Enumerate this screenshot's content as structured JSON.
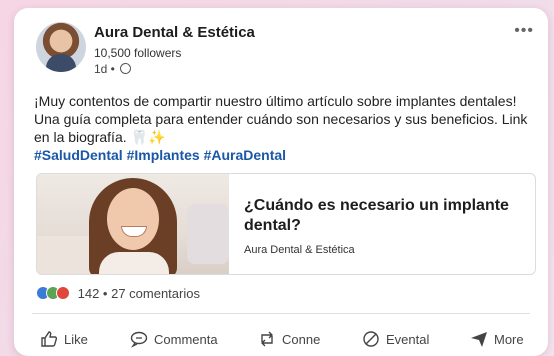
{
  "post": {
    "author": "Aura Dental & Estética",
    "followers": "10,500 followers",
    "time": "1d •",
    "menu_label": "•••",
    "body": "¡Muy contentos de compartir nuestro último artículo sobre implantes dentales! Una guía completa para entender cuándo son necesarios y sus beneficios. Link en la biografía. 🦷✨",
    "hashtags": "#SaludDental #Implantes #AuraDental"
  },
  "link_preview": {
    "title": "¿Cuándo es necesario un implante dental?",
    "source": "Aura Dental & Estética"
  },
  "reactions": {
    "count_text": "142 • 27 comentarios",
    "colors": {
      "like": "#3a7bd5",
      "celebrate": "#5aa453",
      "love": "#e0473c"
    }
  },
  "actions": {
    "like": "Like",
    "comment": "Commenta",
    "repost": "Conne",
    "send_alt": "Evental",
    "more": "More"
  },
  "icons": [
    "thumbs-up-icon",
    "comment-icon",
    "repost-icon",
    "block-icon",
    "send-icon",
    "globe-icon",
    "more-icon"
  ],
  "accent_color": "#1a57a8"
}
